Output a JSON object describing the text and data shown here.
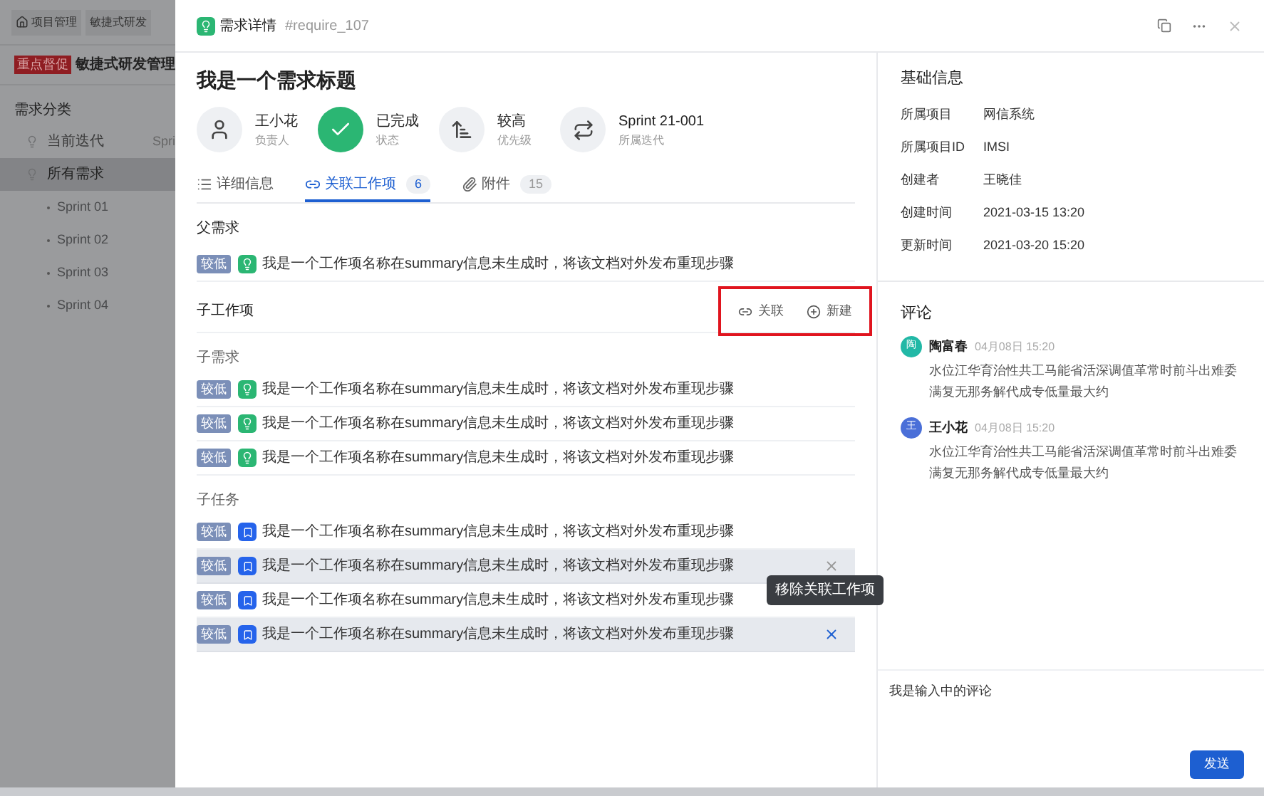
{
  "background": {
    "nav": [
      "项目管理",
      "敏捷式研发"
    ],
    "project": {
      "tag": "重点督促",
      "name": "敏捷式研发管理"
    },
    "sidebar": {
      "title": "需求分类",
      "items": [
        {
          "label": "当前迭代",
          "extra": "Spri",
          "selected": false
        },
        {
          "label": "所有需求",
          "selected": true,
          "children": [
            {
              "label": "Sprint 01"
            },
            {
              "label": "Sprint 02"
            },
            {
              "label": "Sprint 03"
            },
            {
              "label": "Sprint 04"
            }
          ]
        }
      ]
    }
  },
  "drawer": {
    "type": "需求详情",
    "id": "#require_107",
    "title": "我是一个需求标题",
    "fields": [
      {
        "kind": "assignee",
        "value": "王小花",
        "label": "负责人"
      },
      {
        "kind": "status",
        "value": "已完成",
        "label": "状态"
      },
      {
        "kind": "priority",
        "value": "较高",
        "label": "优先级"
      },
      {
        "kind": "iteration",
        "value": "Sprint 21-001",
        "label": "所属迭代"
      }
    ],
    "tabs": [
      {
        "kind": "list",
        "label": "详细信息",
        "selected": false
      },
      {
        "kind": "link",
        "label": "关联工作项",
        "count": "6",
        "selected": true
      },
      {
        "kind": "attachment",
        "label": "附件",
        "count": "15",
        "selected": false
      }
    ],
    "parent": {
      "title": "父需求",
      "items": [
        {
          "priority": "较低",
          "kind": "requirement",
          "title": "我是一个工作项名称在summary信息未生成时，将该文档对外发布重现步骤",
          "hovered": false
        }
      ]
    },
    "children": {
      "title": "子工作项",
      "actions": [
        {
          "kind": "link",
          "label": "关联"
        },
        {
          "kind": "create",
          "label": "新建"
        }
      ],
      "groups": [
        {
          "title": "子需求",
          "items": [
            {
              "priority": "较低",
              "kind": "requirement",
              "title": "我是一个工作项名称在summary信息未生成时，将该文档对外发布重现步骤",
              "hovered": false
            },
            {
              "priority": "较低",
              "kind": "requirement",
              "title": "我是一个工作项名称在summary信息未生成时，将该文档对外发布重现步骤",
              "hovered": false
            },
            {
              "priority": "较低",
              "kind": "requirement",
              "title": "我是一个工作项名称在summary信息未生成时，将该文档对外发布重现步骤",
              "hovered": false
            }
          ]
        },
        {
          "title": "子任务",
          "items": [
            {
              "priority": "较低",
              "kind": "task",
              "title": "我是一个工作项名称在summary信息未生成时，将该文档对外发布重现步骤",
              "hovered": false
            },
            {
              "priority": "较低",
              "kind": "task",
              "title": "我是一个工作项名称在summary信息未生成时，将该文档对外发布重现步骤",
              "hovered": true
            },
            {
              "priority": "较低",
              "kind": "task",
              "title": "我是一个工作项名称在summary信息未生成时，将该文档对外发布重现步骤",
              "hovered": false
            },
            {
              "priority": "较低",
              "kind": "task",
              "title": "我是一个工作项名称在summary信息未生成时，将该文档对外发布重现步骤",
              "hovered": true,
              "tooltip": "移除关联工作项"
            }
          ]
        }
      ]
    },
    "info": {
      "title": "基础信息",
      "rows": [
        {
          "label": "所属项目",
          "value": "网信系统"
        },
        {
          "label": "所属项目ID",
          "value": "IMSI"
        },
        {
          "label": "创建者",
          "value": "王晓佳"
        },
        {
          "label": "创建时间",
          "value": "2021-03-15 13:20"
        },
        {
          "label": "更新时间",
          "value": "2021-03-20 15:20"
        }
      ]
    },
    "comments": {
      "title": "评论",
      "items": [
        {
          "avatar": "陶",
          "color": "#22b8a6",
          "name": "陶富春",
          "time": "04月08日 15:20",
          "text": "水位江华育治性共工马能省活深调值革常时前斗出难委满复无那务解代成专低量最大约"
        },
        {
          "avatar": "王",
          "color": "#4a6fd8",
          "name": "王小花",
          "time": "04月08日 15:20",
          "text": "水位江华育治性共工马能省活深调值革常时前斗出难委满复无那务解代成专低量最大约"
        }
      ]
    },
    "composer": {
      "value": "我是输入中的评论",
      "button": "发送"
    }
  }
}
